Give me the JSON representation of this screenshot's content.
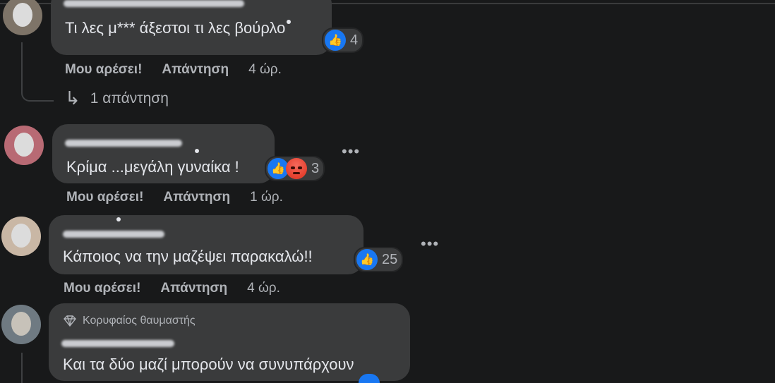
{
  "comments": [
    {
      "text": "Τι λες μ*** άξεστοι τι λες βούρλο",
      "reaction_count": "4",
      "like_label": "Μου αρέσει!",
      "reply_label": "Απάντηση",
      "time": "4 ώρ.",
      "replies_label": "1 απάντηση"
    },
    {
      "text": "Κρίμα ...μεγάλη γυναίκα !",
      "reaction_count": "3",
      "like_label": "Μου αρέσει!",
      "reply_label": "Απάντηση",
      "time": "1 ώρ."
    },
    {
      "text": "Κάποιος να την μαζέψει παρακαλώ!!",
      "reaction_count": "25",
      "like_label": "Μου αρέσει!",
      "reply_label": "Απάντηση",
      "time": "4 ώρ."
    },
    {
      "badge": "Κορυφαίος θαυμαστής",
      "text": "Και τα δύο μαζί μπορούν να συνυπάρχουν"
    }
  ],
  "icons": {
    "like": "thumbs-up-icon",
    "angry": "angry-face-icon",
    "more": "more-options-icon",
    "reply_arrow": "reply-arrow-icon",
    "fan_badge": "diamond-icon"
  },
  "colors": {
    "background": "#18191a",
    "bubble": "#3a3b3c",
    "like_blue": "#1877f2",
    "angry_red": "#e5402e",
    "text": "#e4e6eb",
    "secondary_text": "#b0b3b8"
  }
}
